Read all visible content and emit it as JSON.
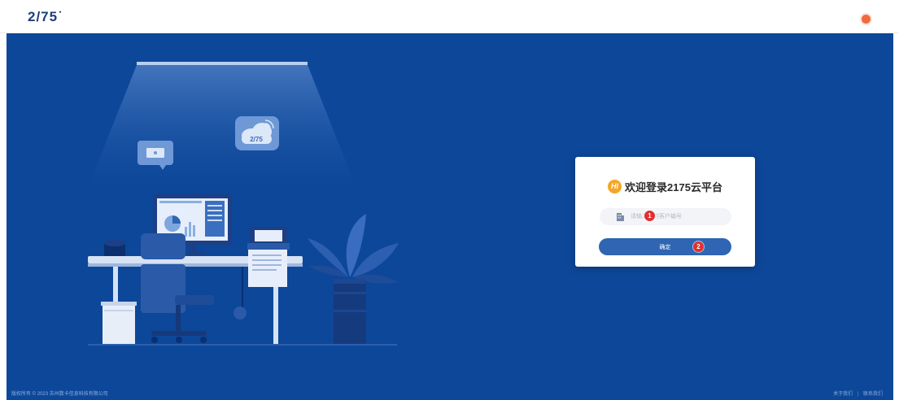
{
  "header": {
    "logo_text": "2/75˙",
    "avatar_color": "#f06a3f"
  },
  "hero": {
    "background_color": "#0d4799",
    "cloud_badge_text": "2/75"
  },
  "login": {
    "title": "欢迎登录2175云平台",
    "hi_badge": "HI",
    "input_placeholder": "请输入您的客户编号",
    "input_value": "",
    "confirm_label": "确定",
    "marker_1": "1",
    "marker_2": "2",
    "accent_color": "#2f65b2",
    "marker_color": "#e0302f"
  },
  "footer": {
    "copyright": "版权所有 © 2023  苏州数卡信息科技有限公司",
    "about_label": "关于我们",
    "separator": "|",
    "contact_label": "联系我们"
  }
}
